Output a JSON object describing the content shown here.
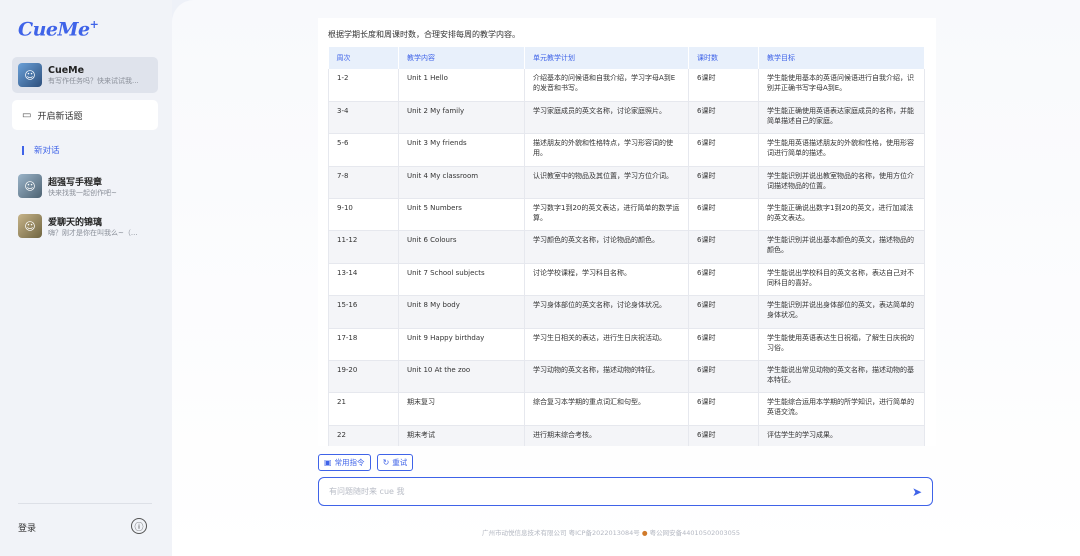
{
  "brand": {
    "name": "CueMe",
    "sup": "+"
  },
  "sidebar": {
    "active_chat": {
      "name": "CueMe",
      "preview": "有写作任务吗？快来试试我..."
    },
    "new_topic_label": "开启新话题",
    "new_chat_label": "新对话",
    "conversations": [
      {
        "name": "超强写手程章",
        "preview": "快来找我一起创作吧~"
      },
      {
        "name": "爱聊天的锦璃",
        "preview": "嗨？刚才是你在叫我么~（..."
      }
    ],
    "login_label": "登录",
    "info_icon": "ⓘ"
  },
  "main": {
    "intro": "根据学期长度和周课时数，合理安排每周的教学内容。",
    "table": {
      "headers": [
        "周次",
        "教学内容",
        "单元教学计划",
        "课时数",
        "教学目标"
      ],
      "rows": [
        [
          "1-2",
          "Unit 1 Hello",
          "介绍基本的问候语和自我介绍，学习字母A到E的发音和书写。",
          "6课时",
          "学生能使用基本的英语问候语进行自我介绍，识别并正确书写字母A到E。"
        ],
        [
          "3-4",
          "Unit 2 My family",
          "学习家庭成员的英文名称，讨论家庭照片。",
          "6课时",
          "学生能正确使用英语表达家庭成员的名称，并能简单描述自己的家庭。"
        ],
        [
          "5-6",
          "Unit 3 My friends",
          "描述朋友的外貌和性格特点，学习形容词的使用。",
          "6课时",
          "学生能用英语描述朋友的外貌和性格，使用形容词进行简单的描述。"
        ],
        [
          "7-8",
          "Unit 4 My classroom",
          "认识教室中的物品及其位置，学习方位介词。",
          "6课时",
          "学生能识别并说出教室物品的名称，使用方位介词描述物品的位置。"
        ],
        [
          "9-10",
          "Unit 5 Numbers",
          "学习数字1到20的英文表达，进行简单的数学运算。",
          "6课时",
          "学生能正确说出数字1到20的英文，进行加减法的英文表达。"
        ],
        [
          "11-12",
          "Unit 6 Colours",
          "学习颜色的英文名称，讨论物品的颜色。",
          "6课时",
          "学生能识别并说出基本颜色的英文，描述物品的颜色。"
        ],
        [
          "13-14",
          "Unit 7 School subjects",
          "讨论学校课程，学习科目名称。",
          "6课时",
          "学生能说出学校科目的英文名称，表达自己对不同科目的喜好。"
        ],
        [
          "15-16",
          "Unit 8 My body",
          "学习身体部位的英文名称，讨论身体状况。",
          "6课时",
          "学生能识别并说出身体部位的英文，表达简单的身体状况。"
        ],
        [
          "17-18",
          "Unit 9 Happy birthday",
          "学习生日相关的表达，进行生日庆祝活动。",
          "6课时",
          "学生能使用英语表达生日祝福，了解生日庆祝的习俗。"
        ],
        [
          "19-20",
          "Unit 10 At the zoo",
          "学习动物的英文名称，描述动物的特征。",
          "6课时",
          "学生能说出常见动物的英文名称，描述动物的基本特征。"
        ],
        [
          "21",
          "期末复习",
          "综合复习本学期的重点词汇和句型。",
          "6课时",
          "学生能综合运用本学期的所学知识，进行简单的英语交流。"
        ],
        [
          "22",
          "期末考试",
          "进行期末综合考核。",
          "6课时",
          "评估学生的学习成果。"
        ]
      ]
    },
    "buttons": {
      "common_commands": "常用指令",
      "retry": "重试"
    },
    "input_placeholder": "有问题随时来 cue 我",
    "footer": {
      "company": "广州市动悦信息技术有限公司",
      "icp": "粤ICP备2022013084号",
      "police": "粤公网安备44010502003055"
    }
  }
}
